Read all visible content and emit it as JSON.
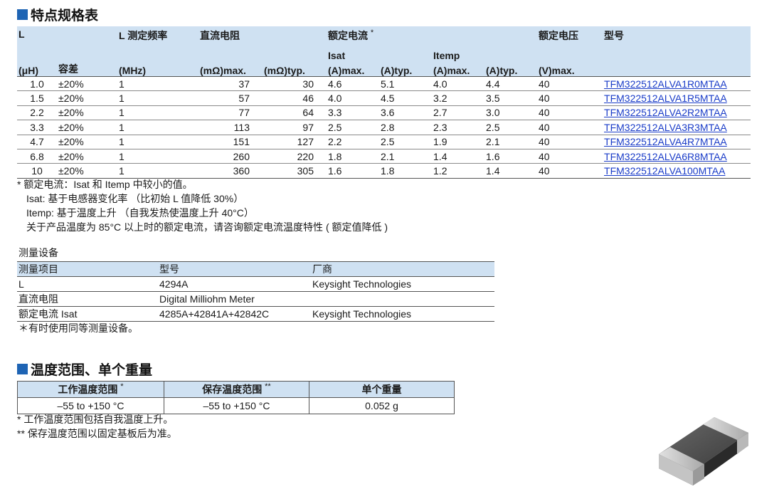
{
  "section1": {
    "title": "特点规格表"
  },
  "spec": {
    "header": {
      "L": "L",
      "freq": "L 测定频率",
      "dcr": "直流电阻",
      "rated_current": "额定电流",
      "rated_current_mark": "*",
      "rated_voltage": "额定电压",
      "part_no": "型号",
      "isat": "Isat",
      "itemp": "Itemp",
      "unit_uh": "(μH)",
      "tolerance": "容差",
      "unit_mhz": "(MHz)",
      "dcr_max": "(mΩ)max.",
      "dcr_typ": "(mΩ)typ.",
      "isat_max": "(A)max.",
      "isat_typ": "(A)typ.",
      "itemp_max": "(A)max.",
      "itemp_typ": "(A)typ.",
      "volt_max": "(V)max."
    },
    "rows": [
      [
        "1.0",
        "±20%",
        "1",
        "37",
        "30",
        "4.6",
        "5.1",
        "4.0",
        "4.4",
        "40",
        "TFM322512ALVA1R0MTAA"
      ],
      [
        "1.5",
        "±20%",
        "1",
        "57",
        "46",
        "4.0",
        "4.5",
        "3.2",
        "3.5",
        "40",
        "TFM322512ALVA1R5MTAA"
      ],
      [
        "2.2",
        "±20%",
        "1",
        "77",
        "64",
        "3.3",
        "3.6",
        "2.7",
        "3.0",
        "40",
        "TFM322512ALVA2R2MTAA"
      ],
      [
        "3.3",
        "±20%",
        "1",
        "113",
        "97",
        "2.5",
        "2.8",
        "2.3",
        "2.5",
        "40",
        "TFM322512ALVA3R3MTAA"
      ],
      [
        "4.7",
        "±20%",
        "1",
        "151",
        "127",
        "2.2",
        "2.5",
        "1.9",
        "2.1",
        "40",
        "TFM322512ALVA4R7MTAA"
      ],
      [
        "6.8",
        "±20%",
        "1",
        "260",
        "220",
        "1.8",
        "2.1",
        "1.4",
        "1.6",
        "40",
        "TFM322512ALVA6R8MTAA"
      ],
      [
        "10",
        "±20%",
        "1",
        "360",
        "305",
        "1.6",
        "1.8",
        "1.2",
        "1.4",
        "40",
        "TFM322512ALVA100MTAA"
      ]
    ]
  },
  "spec_notes": [
    "* 额定电流：Isat 和 Itemp 中较小的值。",
    "Isat: 基于电感器变化率 （比初始 L 值降低 30%）",
    "Itemp: 基于温度上升 （自我发热使温度上升 40°C）",
    "关于产品温度为 85°C 以上时的额定电流，请咨询额定电流温度特性 ( 额定值降低 )"
  ],
  "measurement": {
    "caption": "测量设备",
    "headers": [
      "测量项目",
      "型号",
      "厂商"
    ],
    "rows": [
      [
        "L",
        "4294A",
        "Keysight Technologies"
      ],
      [
        "直流电阻",
        "Digital Milliohm Meter",
        ""
      ],
      [
        "额定电流 Isat",
        "4285A+42841A+42842C",
        "Keysight Technologies"
      ]
    ],
    "note": "＊有时使用同等测量设备。"
  },
  "section2": {
    "title": "温度范围、单个重量"
  },
  "temperature": {
    "headers": [
      "工作温度范围",
      "保存温度范围",
      "单个重量"
    ],
    "header_marks": [
      "*",
      "**",
      ""
    ],
    "values": [
      "–55 to +150 °C",
      "–55 to +150 °C",
      "0.052 g"
    ],
    "notes": [
      "*   工作温度范围包括自我温度上升。",
      "** 保存温度范围以固定基板后为准。"
    ]
  },
  "colors": {
    "accent": "#1e64b4",
    "header_bg": "#cfe1f2",
    "link": "#1a3cc8"
  }
}
